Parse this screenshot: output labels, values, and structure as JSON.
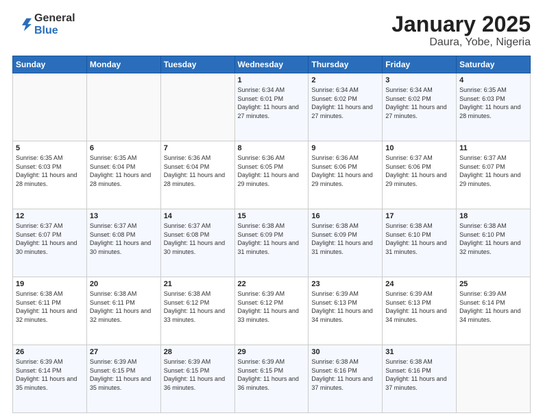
{
  "header": {
    "logo_general": "General",
    "logo_blue": "Blue",
    "title": "January 2025",
    "subtitle": "Daura, Yobe, Nigeria"
  },
  "days_of_week": [
    "Sunday",
    "Monday",
    "Tuesday",
    "Wednesday",
    "Thursday",
    "Friday",
    "Saturday"
  ],
  "weeks": [
    [
      {
        "day": "",
        "info": ""
      },
      {
        "day": "",
        "info": ""
      },
      {
        "day": "",
        "info": ""
      },
      {
        "day": "1",
        "info": "Sunrise: 6:34 AM\nSunset: 6:01 PM\nDaylight: 11 hours and 27 minutes."
      },
      {
        "day": "2",
        "info": "Sunrise: 6:34 AM\nSunset: 6:02 PM\nDaylight: 11 hours and 27 minutes."
      },
      {
        "day": "3",
        "info": "Sunrise: 6:34 AM\nSunset: 6:02 PM\nDaylight: 11 hours and 27 minutes."
      },
      {
        "day": "4",
        "info": "Sunrise: 6:35 AM\nSunset: 6:03 PM\nDaylight: 11 hours and 28 minutes."
      }
    ],
    [
      {
        "day": "5",
        "info": "Sunrise: 6:35 AM\nSunset: 6:03 PM\nDaylight: 11 hours and 28 minutes."
      },
      {
        "day": "6",
        "info": "Sunrise: 6:35 AM\nSunset: 6:04 PM\nDaylight: 11 hours and 28 minutes."
      },
      {
        "day": "7",
        "info": "Sunrise: 6:36 AM\nSunset: 6:04 PM\nDaylight: 11 hours and 28 minutes."
      },
      {
        "day": "8",
        "info": "Sunrise: 6:36 AM\nSunset: 6:05 PM\nDaylight: 11 hours and 29 minutes."
      },
      {
        "day": "9",
        "info": "Sunrise: 6:36 AM\nSunset: 6:06 PM\nDaylight: 11 hours and 29 minutes."
      },
      {
        "day": "10",
        "info": "Sunrise: 6:37 AM\nSunset: 6:06 PM\nDaylight: 11 hours and 29 minutes."
      },
      {
        "day": "11",
        "info": "Sunrise: 6:37 AM\nSunset: 6:07 PM\nDaylight: 11 hours and 29 minutes."
      }
    ],
    [
      {
        "day": "12",
        "info": "Sunrise: 6:37 AM\nSunset: 6:07 PM\nDaylight: 11 hours and 30 minutes."
      },
      {
        "day": "13",
        "info": "Sunrise: 6:37 AM\nSunset: 6:08 PM\nDaylight: 11 hours and 30 minutes."
      },
      {
        "day": "14",
        "info": "Sunrise: 6:37 AM\nSunset: 6:08 PM\nDaylight: 11 hours and 30 minutes."
      },
      {
        "day": "15",
        "info": "Sunrise: 6:38 AM\nSunset: 6:09 PM\nDaylight: 11 hours and 31 minutes."
      },
      {
        "day": "16",
        "info": "Sunrise: 6:38 AM\nSunset: 6:09 PM\nDaylight: 11 hours and 31 minutes."
      },
      {
        "day": "17",
        "info": "Sunrise: 6:38 AM\nSunset: 6:10 PM\nDaylight: 11 hours and 31 minutes."
      },
      {
        "day": "18",
        "info": "Sunrise: 6:38 AM\nSunset: 6:10 PM\nDaylight: 11 hours and 32 minutes."
      }
    ],
    [
      {
        "day": "19",
        "info": "Sunrise: 6:38 AM\nSunset: 6:11 PM\nDaylight: 11 hours and 32 minutes."
      },
      {
        "day": "20",
        "info": "Sunrise: 6:38 AM\nSunset: 6:11 PM\nDaylight: 11 hours and 32 minutes."
      },
      {
        "day": "21",
        "info": "Sunrise: 6:38 AM\nSunset: 6:12 PM\nDaylight: 11 hours and 33 minutes."
      },
      {
        "day": "22",
        "info": "Sunrise: 6:39 AM\nSunset: 6:12 PM\nDaylight: 11 hours and 33 minutes."
      },
      {
        "day": "23",
        "info": "Sunrise: 6:39 AM\nSunset: 6:13 PM\nDaylight: 11 hours and 34 minutes."
      },
      {
        "day": "24",
        "info": "Sunrise: 6:39 AM\nSunset: 6:13 PM\nDaylight: 11 hours and 34 minutes."
      },
      {
        "day": "25",
        "info": "Sunrise: 6:39 AM\nSunset: 6:14 PM\nDaylight: 11 hours and 34 minutes."
      }
    ],
    [
      {
        "day": "26",
        "info": "Sunrise: 6:39 AM\nSunset: 6:14 PM\nDaylight: 11 hours and 35 minutes."
      },
      {
        "day": "27",
        "info": "Sunrise: 6:39 AM\nSunset: 6:15 PM\nDaylight: 11 hours and 35 minutes."
      },
      {
        "day": "28",
        "info": "Sunrise: 6:39 AM\nSunset: 6:15 PM\nDaylight: 11 hours and 36 minutes."
      },
      {
        "day": "29",
        "info": "Sunrise: 6:39 AM\nSunset: 6:15 PM\nDaylight: 11 hours and 36 minutes."
      },
      {
        "day": "30",
        "info": "Sunrise: 6:38 AM\nSunset: 6:16 PM\nDaylight: 11 hours and 37 minutes."
      },
      {
        "day": "31",
        "info": "Sunrise: 6:38 AM\nSunset: 6:16 PM\nDaylight: 11 hours and 37 minutes."
      },
      {
        "day": "",
        "info": ""
      }
    ]
  ]
}
